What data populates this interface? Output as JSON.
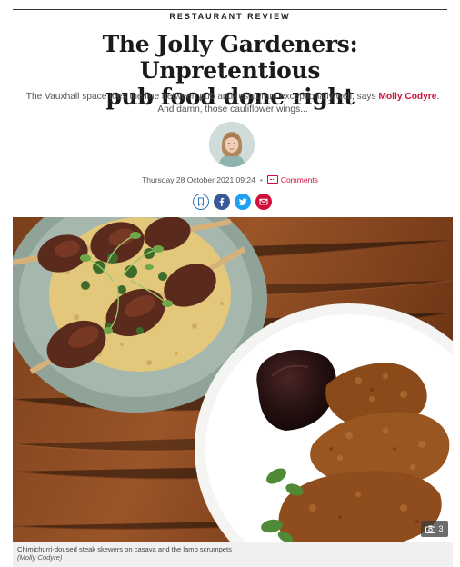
{
  "kicker": "RESTAURANT REVIEW",
  "headline_line1": "The Jolly Gardeners: Unpretentious",
  "headline_line2": "pub food done right",
  "standfirst": {
    "before": "The Vauxhall space toes the line between pub and restaurant exceptionally well, says ",
    "author": "Molly Codyre",
    "after": ". And damn, those cauliflower wings..."
  },
  "meta": {
    "date": "Thursday 28 October 2021 09:24",
    "comments_label": "Comments"
  },
  "share": [
    "bookmark-icon",
    "facebook-icon",
    "twitter-icon",
    "email-icon"
  ],
  "gallery": {
    "count": "3"
  },
  "photo": {
    "caption": "Chimichurri-doused steak skewers on casava and the lamb scrumpets",
    "credit": "(Molly Codyre)"
  },
  "colors": {
    "accent": "#d0103a",
    "facebook": "#3b5998",
    "twitter": "#1da1f2",
    "bookmark": "#2f75b5"
  }
}
